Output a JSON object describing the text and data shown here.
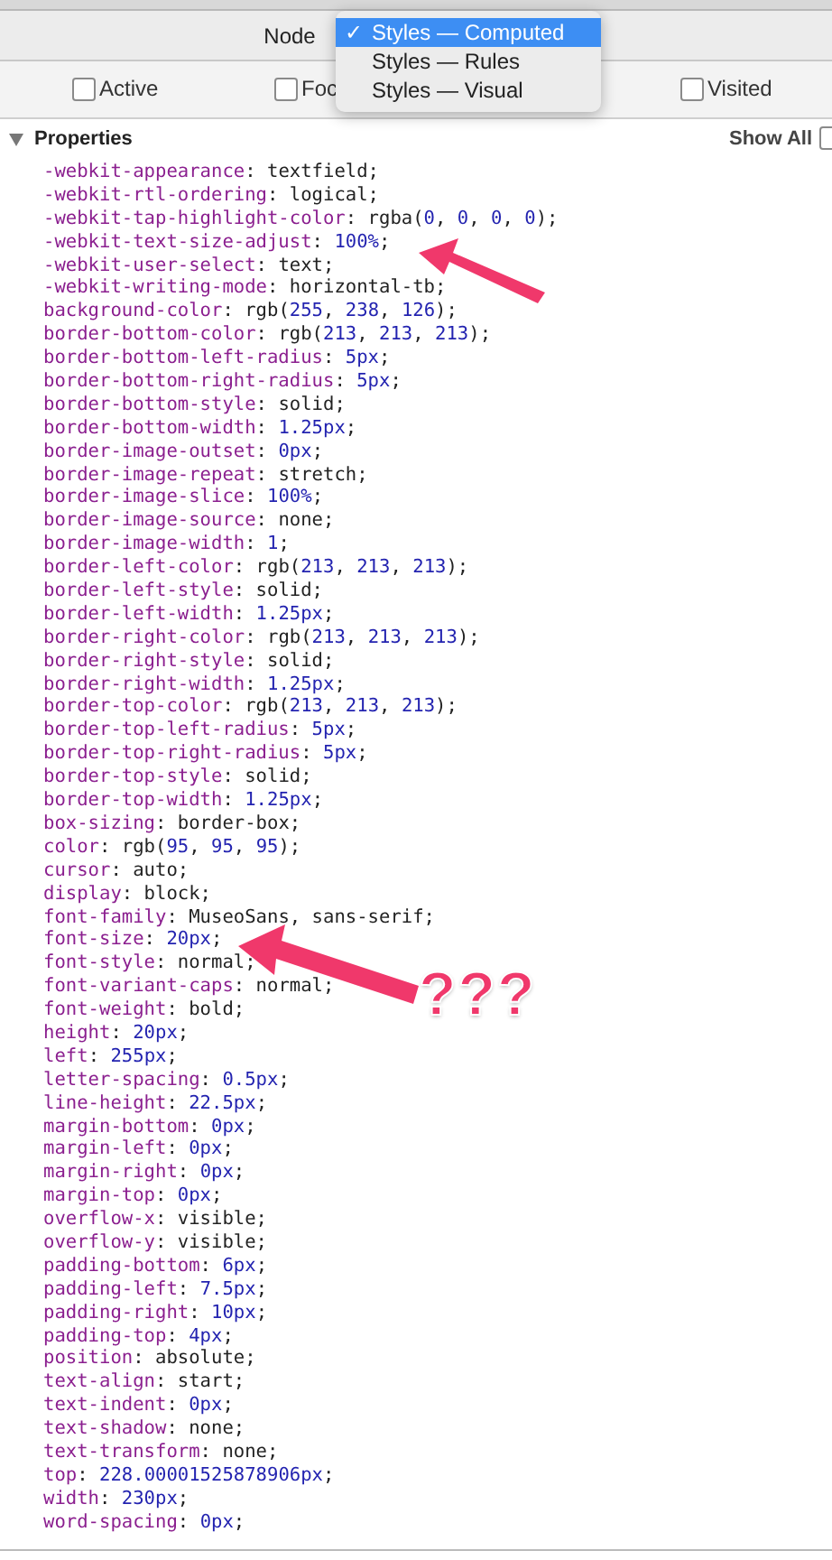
{
  "node_bar": {
    "label": "Node"
  },
  "dropdown": {
    "check_mark": "✓",
    "items": [
      {
        "label": "Styles — Computed",
        "selected": true
      },
      {
        "label": "Styles — Rules",
        "selected": false
      },
      {
        "label": "Styles — Visual",
        "selected": false
      }
    ]
  },
  "pseudo_classes": [
    {
      "label": "Active",
      "checked": false
    },
    {
      "label": "Foc",
      "checked": false
    },
    {
      "label": "Visited",
      "checked": false
    }
  ],
  "properties": {
    "title": "Properties",
    "expanded": true,
    "show_all": {
      "label": "Show All",
      "checked": false
    },
    "items": [
      "-webkit-appearance: textfield;",
      "-webkit-rtl-ordering: logical;",
      "-webkit-tap-highlight-color: rgba(0, 0, 0, 0);",
      "-webkit-text-size-adjust: 100%;",
      "-webkit-user-select: text;",
      "-webkit-writing-mode: horizontal-tb;",
      "background-color: rgb(255, 238, 126);",
      "border-bottom-color: rgb(213, 213, 213);",
      "border-bottom-left-radius: 5px;",
      "border-bottom-right-radius: 5px;",
      "border-bottom-style: solid;",
      "border-bottom-width: 1.25px;",
      "border-image-outset: 0px;",
      "border-image-repeat: stretch;",
      "border-image-slice: 100%;",
      "border-image-source: none;",
      "border-image-width: 1;",
      "border-left-color: rgb(213, 213, 213);",
      "border-left-style: solid;",
      "border-left-width: 1.25px;",
      "border-right-color: rgb(213, 213, 213);",
      "border-right-style: solid;",
      "border-right-width: 1.25px;",
      "border-top-color: rgb(213, 213, 213);",
      "border-top-left-radius: 5px;",
      "border-top-right-radius: 5px;",
      "border-top-style: solid;",
      "border-top-width: 1.25px;",
      "box-sizing: border-box;",
      "color: rgb(95, 95, 95);",
      "cursor: auto;",
      "display: block;",
      "font-family: MuseoSans, sans-serif;",
      "font-size: 20px;",
      "font-style: normal;",
      "font-variant-caps: normal;",
      "font-weight: bold;",
      "height: 20px;",
      "left: 255px;",
      "letter-spacing: 0.5px;",
      "line-height: 22.5px;",
      "margin-bottom: 0px;",
      "margin-left: 0px;",
      "margin-right: 0px;",
      "margin-top: 0px;",
      "overflow-x: visible;",
      "overflow-y: visible;",
      "padding-bottom: 6px;",
      "padding-left: 7.5px;",
      "padding-right: 10px;",
      "padding-top: 4px;",
      "position: absolute;",
      "text-align: start;",
      "text-indent: 0px;",
      "text-shadow: none;",
      "text-transform: none;",
      "top: 228.00001525878906px;",
      "width: 230px;",
      "word-spacing: 0px;"
    ]
  },
  "annotations": [
    {
      "kind": "arrow"
    },
    {
      "kind": "arrow_with_label",
      "label": "???"
    }
  ]
}
